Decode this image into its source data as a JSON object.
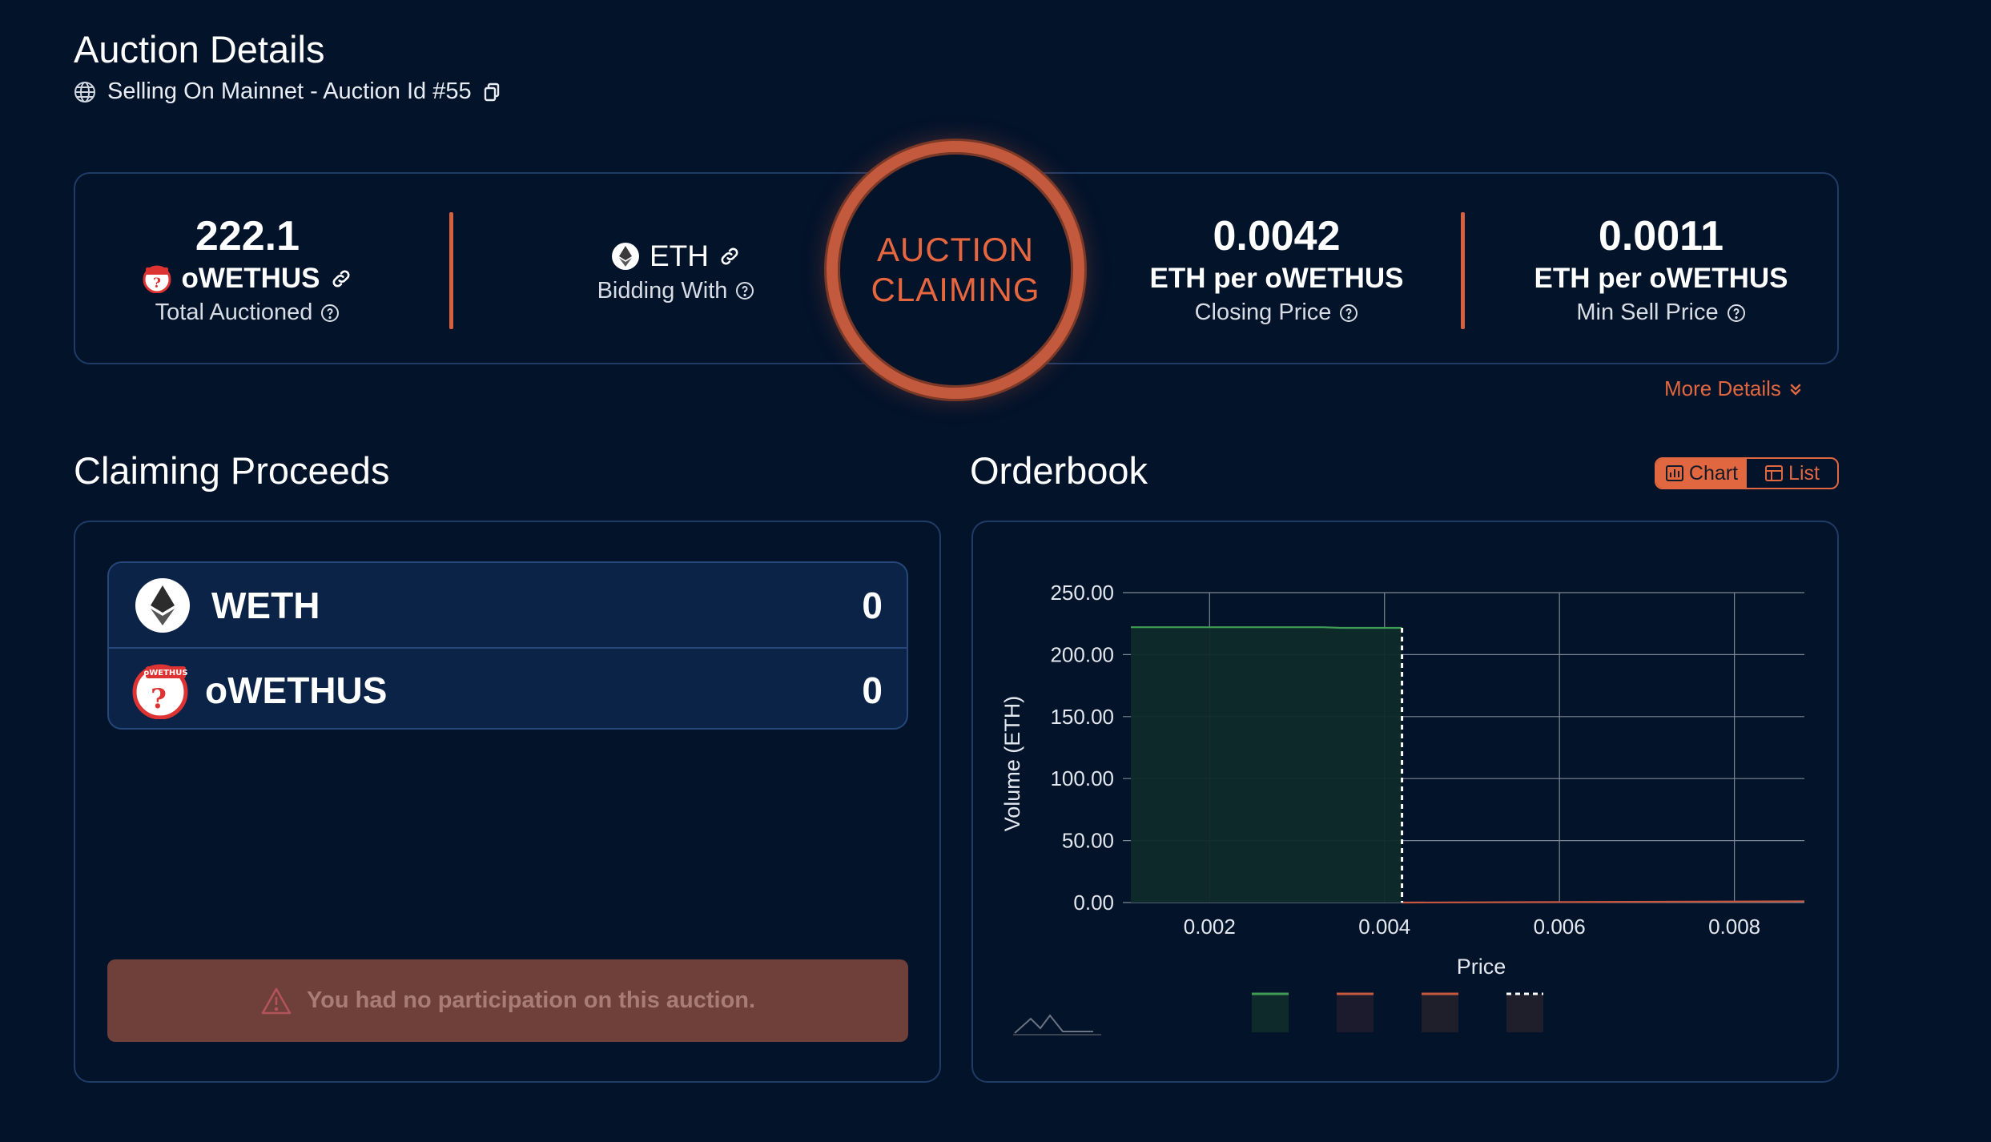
{
  "header": {
    "title": "Auction Details",
    "subtitle": "Selling On Mainnet - Auction Id #55",
    "icons": [
      "globe-icon",
      "copy-icon"
    ]
  },
  "summary": {
    "total_auctioned": {
      "value": "222.1",
      "token": "oWETHUS",
      "label": "Total Auctioned"
    },
    "bidding_with": {
      "token": "ETH",
      "label": "Bidding With"
    },
    "status": {
      "line1": "AUCTION",
      "line2": "CLAIMING"
    },
    "closing_price": {
      "value": "0.0042",
      "unit": "ETH per oWETHUS",
      "label": "Closing Price"
    },
    "min_sell_price": {
      "value": "0.0011",
      "unit": "ETH per oWETHUS",
      "label": "Min Sell Price"
    },
    "more_details": "More Details",
    "accent_color": "#e0673f"
  },
  "claiming": {
    "title": "Claiming Proceeds",
    "items": [
      {
        "token": "WETH",
        "amount": "0",
        "icon": "eth-icon"
      },
      {
        "token": "oWETHUS",
        "amount": "0",
        "icon": "owethus-icon"
      }
    ],
    "alert": "You had no participation on this auction."
  },
  "orderbook": {
    "title": "Orderbook",
    "toggle": {
      "chart": "Chart",
      "list": "List",
      "active": "chart"
    }
  },
  "chart_data": {
    "type": "area",
    "xlabel": "Price",
    "ylabel": "Volume (ETH)",
    "xlim": [
      0.0011,
      0.0088
    ],
    "ylim": [
      0,
      250
    ],
    "x_ticks": [
      "0.002",
      "0.004",
      "0.006",
      "0.008"
    ],
    "y_ticks": [
      "250.00",
      "200.00",
      "150.00",
      "100.00",
      "50.00",
      "0.00"
    ],
    "grid": true,
    "series": [
      {
        "color": "#3f9c55",
        "fill": "#0f2a2a",
        "points": [
          [
            0.0011,
            222.1
          ],
          [
            0.0033,
            222.1
          ],
          [
            0.0035,
            221.6
          ],
          [
            0.0042,
            221.6
          ],
          [
            0.0042,
            0
          ]
        ]
      },
      {
        "color": "#c8563e",
        "points": [
          [
            0.0042,
            0
          ],
          [
            0.0088,
            1
          ]
        ]
      }
    ],
    "clearing_price": 0.0042,
    "legend_swatches": [
      {
        "line": "#3f9c55",
        "fill": "#0f2a2a",
        "dashed": false
      },
      {
        "line": "#c45a3d",
        "fill": "#1c1b2e",
        "dashed": false
      },
      {
        "line": "#c45a3d",
        "fill": "#1f1f2c",
        "dashed": false
      },
      {
        "line": "#ffffff",
        "fill": "#1f1f2c",
        "dashed": true
      }
    ]
  }
}
